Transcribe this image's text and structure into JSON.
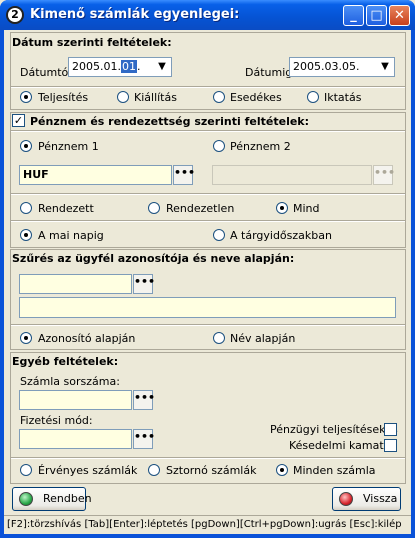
{
  "window": {
    "title": "Kimenő számlák egyenlegei:",
    "app_icon": "app-logo-icon",
    "controls": {
      "minimize": "_",
      "maximize": "□",
      "close": "✕"
    }
  },
  "date_section": {
    "heading": "Dátum szerinti feltételek:",
    "from_label": "Dátumtól:",
    "from_value_prefix": "2005.01.",
    "from_value_selected": "01",
    "from_value_suffix": ".",
    "to_label": "Dátumig:",
    "to_value": "2005.03.05.",
    "dropdown_arrow": "▼",
    "radios": [
      {
        "label": "Teljesítés",
        "selected": true
      },
      {
        "label": "Kiállítás",
        "selected": false
      },
      {
        "label": "Esedékes",
        "selected": false
      },
      {
        "label": "Iktatás",
        "selected": false
      }
    ]
  },
  "currency_section": {
    "checkbox_checked": true,
    "checkbox_mark": "✓",
    "heading": "Pénznem és rendezettség szerinti feltételek:",
    "currency1_label": "Pénznem 1",
    "currency2_label": "Pénznem 2",
    "currency1_value": "HUF",
    "currency2_value": "",
    "ellipsis": "•••",
    "settle_radios": [
      {
        "label": "Rendezett",
        "selected": false
      },
      {
        "label": "Rendezetlen",
        "selected": false
      },
      {
        "label": "Mind",
        "selected": true
      }
    ],
    "period_radios": [
      {
        "label": "A mai napig",
        "selected": true
      },
      {
        "label": "A tárgyidőszakban",
        "selected": false
      }
    ]
  },
  "customer_section": {
    "heading": "Szűrés az ügyfél azonosítója és neve alapján:",
    "id_value": "",
    "name_value": "",
    "radios": [
      {
        "label": "Azonosító alapján",
        "selected": true
      },
      {
        "label": "Név alapján",
        "selected": false
      }
    ]
  },
  "other_section": {
    "heading": "Egyéb feltételek:",
    "serial_label": "Számla sorszáma:",
    "serial_value": "",
    "payment_label": "Fizetési mód:",
    "payment_value": "",
    "financial_label": "Pénzügyi teljesítések is",
    "financial_checked": false,
    "late_label": "Késedelmi kamatok",
    "late_checked": false,
    "invoice_radios": [
      {
        "label": "Érvényes számlák",
        "selected": false
      },
      {
        "label": "Sztornó számlák",
        "selected": false
      },
      {
        "label": "Minden számla",
        "selected": true
      }
    ]
  },
  "buttons": {
    "ok_label": "Rendben",
    "ok_icon": "green-gem-icon",
    "ok_color": "#2BA84A",
    "back_label": "Vissza",
    "back_icon": "red-gem-icon",
    "back_color": "#D8262E"
  },
  "statusbar": {
    "text": "[F2]:törzshívás  [Tab][Enter]:léptetés  [pgDown][Ctrl+pgDown]:ugrás  [Esc]:kilép"
  }
}
